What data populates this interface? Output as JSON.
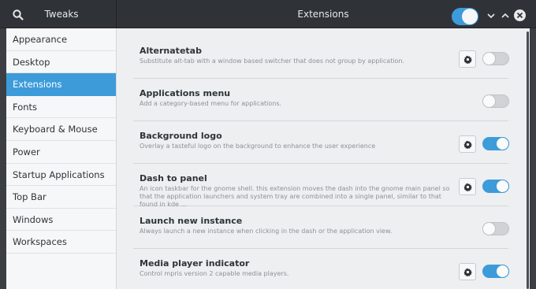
{
  "header": {
    "left_title": "Tweaks",
    "title": "Extensions",
    "global_switch_on": true,
    "search_icon": "search-icon",
    "minimize_icon": "chevron-down-icon",
    "maximize_icon": "chevron-up-icon",
    "close_icon": "close-icon"
  },
  "sidebar": {
    "items": [
      {
        "label": "Appearance",
        "active": false
      },
      {
        "label": "Desktop",
        "active": false
      },
      {
        "label": "Extensions",
        "active": true
      },
      {
        "label": "Fonts",
        "active": false
      },
      {
        "label": "Keyboard & Mouse",
        "active": false
      },
      {
        "label": "Power",
        "active": false
      },
      {
        "label": "Startup Applications",
        "active": false
      },
      {
        "label": "Top Bar",
        "active": false
      },
      {
        "label": "Windows",
        "active": false
      },
      {
        "label": "Workspaces",
        "active": false
      }
    ]
  },
  "extensions": [
    {
      "title": "Alternatetab",
      "desc": "Substitute alt-tab with a window based switcher that does not group by application.",
      "has_settings": true,
      "enabled": false
    },
    {
      "title": "Applications menu",
      "desc": "Add a category-based menu for applications.",
      "has_settings": false,
      "enabled": false
    },
    {
      "title": "Background logo",
      "desc": "Overlay a tasteful logo on the background to enhance the user experience",
      "has_settings": true,
      "enabled": true
    },
    {
      "title": "Dash to panel",
      "desc": "An icon taskbar for the gnome shell. this extension moves the dash into the gnome main panel so that the application launchers and system tray are combined into a single panel, similar to that found in kde ...",
      "has_settings": true,
      "enabled": true
    },
    {
      "title": "Launch new instance",
      "desc": "Always launch a new instance when clicking in the dash or the application view.",
      "has_settings": false,
      "enabled": false
    },
    {
      "title": "Media player indicator",
      "desc": "Control mpris version 2 capable media players.",
      "has_settings": true,
      "enabled": true
    }
  ],
  "colors": {
    "accent": "#3d9bda",
    "headerbar": "#2f3338",
    "sidebar_bg": "#f6f7f8",
    "content_bg": "#edeff1"
  }
}
